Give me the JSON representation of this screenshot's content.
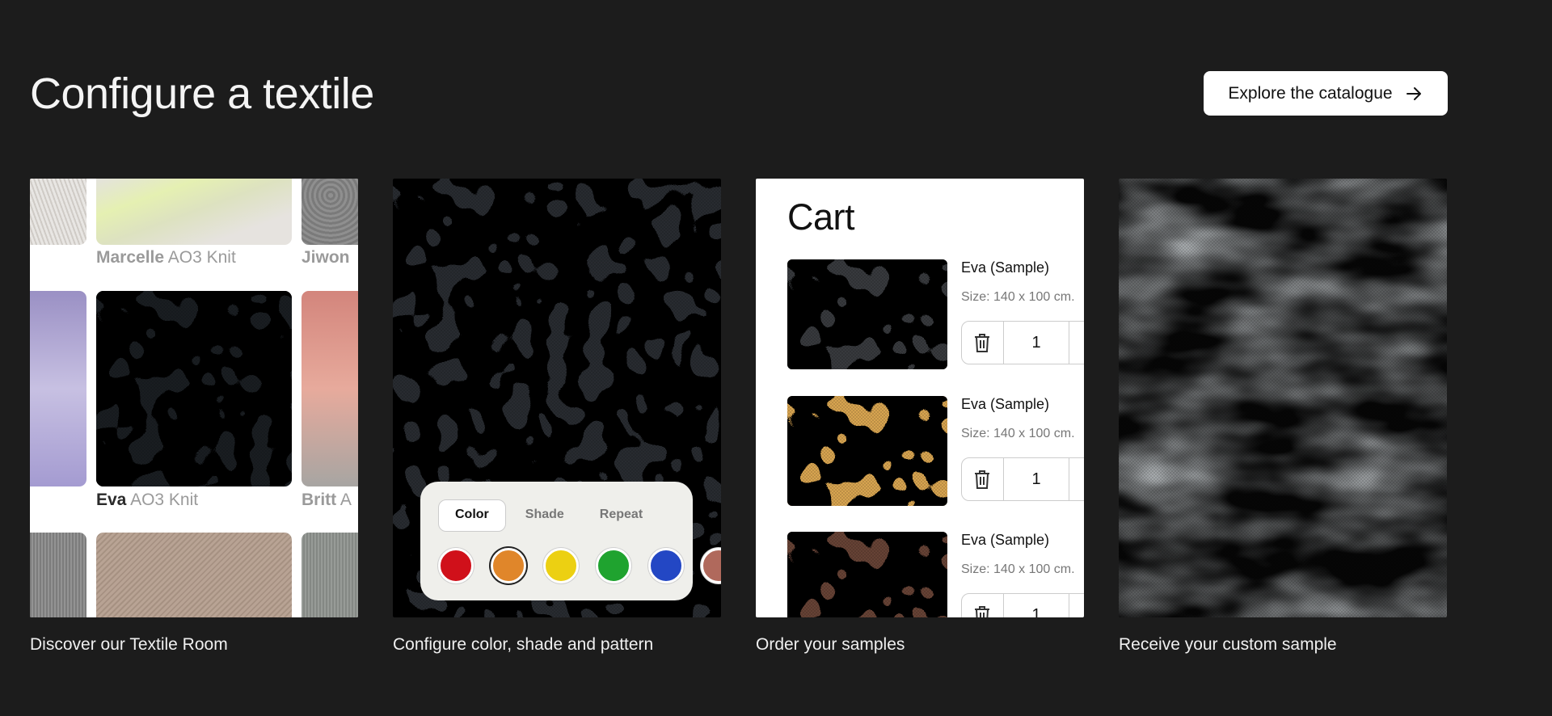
{
  "header": {
    "title": "Configure a textile",
    "cta_label": "Explore the catalogue",
    "cta_icon": "arrow-right-icon"
  },
  "cards": [
    {
      "caption": "Discover our Textile Room"
    },
    {
      "caption": "Configure color, shade and pattern"
    },
    {
      "caption": "Order your samples"
    },
    {
      "caption": "Receive your custom sample"
    }
  ],
  "textile_room": {
    "items": [
      {
        "name": "Marcelle",
        "type": "AO3 Knit"
      },
      {
        "name": "Jiwon",
        "type": ""
      },
      {
        "name": "Eva",
        "type": "AO3 Knit"
      },
      {
        "name": "Britt",
        "type": "A"
      }
    ]
  },
  "configurator": {
    "tabs": [
      "Color",
      "Shade",
      "Repeat"
    ],
    "active_tab": "Color",
    "swatches": [
      "#d0101a",
      "#e0862a",
      "#ecd012",
      "#1fa32f",
      "#2347c4",
      "#b0695c"
    ],
    "selected_swatch": 1
  },
  "cart": {
    "title": "Cart",
    "items": [
      {
        "name": "Eva (Sample)",
        "size": "Size: 140 x 100 cm.",
        "qty": "1",
        "color": "gray"
      },
      {
        "name": "Eva (Sample)",
        "size": "Size: 140 x 100 cm.",
        "qty": "1",
        "color": "gold"
      },
      {
        "name": "Eva (Sample)",
        "size": "Size: 140 x 100 cm.",
        "qty": "1",
        "color": "brown"
      }
    ]
  }
}
